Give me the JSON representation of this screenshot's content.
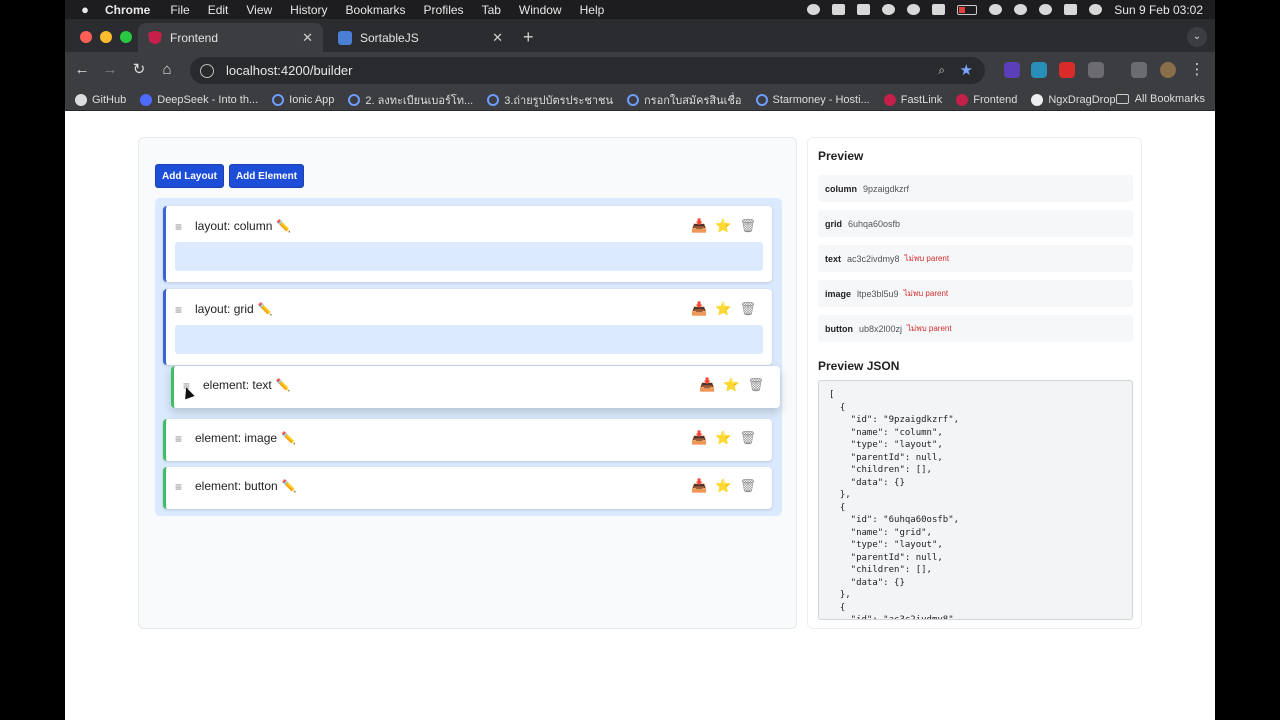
{
  "menubar": {
    "app": "Chrome",
    "items": [
      "File",
      "Edit",
      "View",
      "History",
      "Bookmarks",
      "Profiles",
      "Tab",
      "Window",
      "Help"
    ],
    "clock": "Sun 9 Feb  03:02"
  },
  "tabs": [
    {
      "title": "Frontend",
      "close": "✕"
    },
    {
      "title": "SortableJS",
      "close": "✕"
    }
  ],
  "toolbar": {
    "url": "localhost:4200/builder"
  },
  "bookmarks": {
    "items": [
      "GitHub",
      "DeepSeek - Into th...",
      "Ionic App",
      "2. ลงทะเบียนเบอร์โท...",
      "3.ถ่ายรูปบัตรประชาชน",
      "กรอกใบสมัครสินเชื่อ",
      "Starmoney - Hosti...",
      "FastLink",
      "Frontend",
      "NgxDragDrop"
    ],
    "all": "All Bookmarks"
  },
  "builder": {
    "add_layout": "Add Layout",
    "add_element": "Add Element",
    "items": [
      {
        "title": "layout: column",
        "kind": "layout"
      },
      {
        "title": "layout: grid",
        "kind": "layout"
      },
      {
        "title": "element: text",
        "kind": "element"
      },
      {
        "title": "element: image",
        "kind": "element"
      },
      {
        "title": "element: button",
        "kind": "element"
      }
    ],
    "icons": {
      "handle": "≡",
      "edit": "✏️",
      "move": "📥",
      "star": "⭐",
      "trash": "🗑"
    }
  },
  "preview": {
    "heading": "Preview",
    "rows": [
      {
        "name": "column",
        "id": "9pzaigdkzrf",
        "warn": ""
      },
      {
        "name": "grid",
        "id": "6uhqa60osfb",
        "warn": ""
      },
      {
        "name": "text",
        "id": "ac3c2ivdmy8",
        "warn": "ไม่พบ parent"
      },
      {
        "name": "image",
        "id": "ltpe3bl5u9",
        "warn": "ไม่พบ parent"
      },
      {
        "name": "button",
        "id": "ub8x2l00zj",
        "warn": "ไม่พบ parent"
      }
    ],
    "json_heading": "Preview JSON",
    "json_text": "[\n  {\n    \"id\": \"9pzaigdkzrf\",\n    \"name\": \"column\",\n    \"type\": \"layout\",\n    \"parentId\": null,\n    \"children\": [],\n    \"data\": {}\n  },\n  {\n    \"id\": \"6uhqa60osfb\",\n    \"name\": \"grid\",\n    \"type\": \"layout\",\n    \"parentId\": null,\n    \"children\": [],\n    \"data\": {}\n  },\n  {\n    \"id\": \"ac3c2ivdmy8\","
  }
}
